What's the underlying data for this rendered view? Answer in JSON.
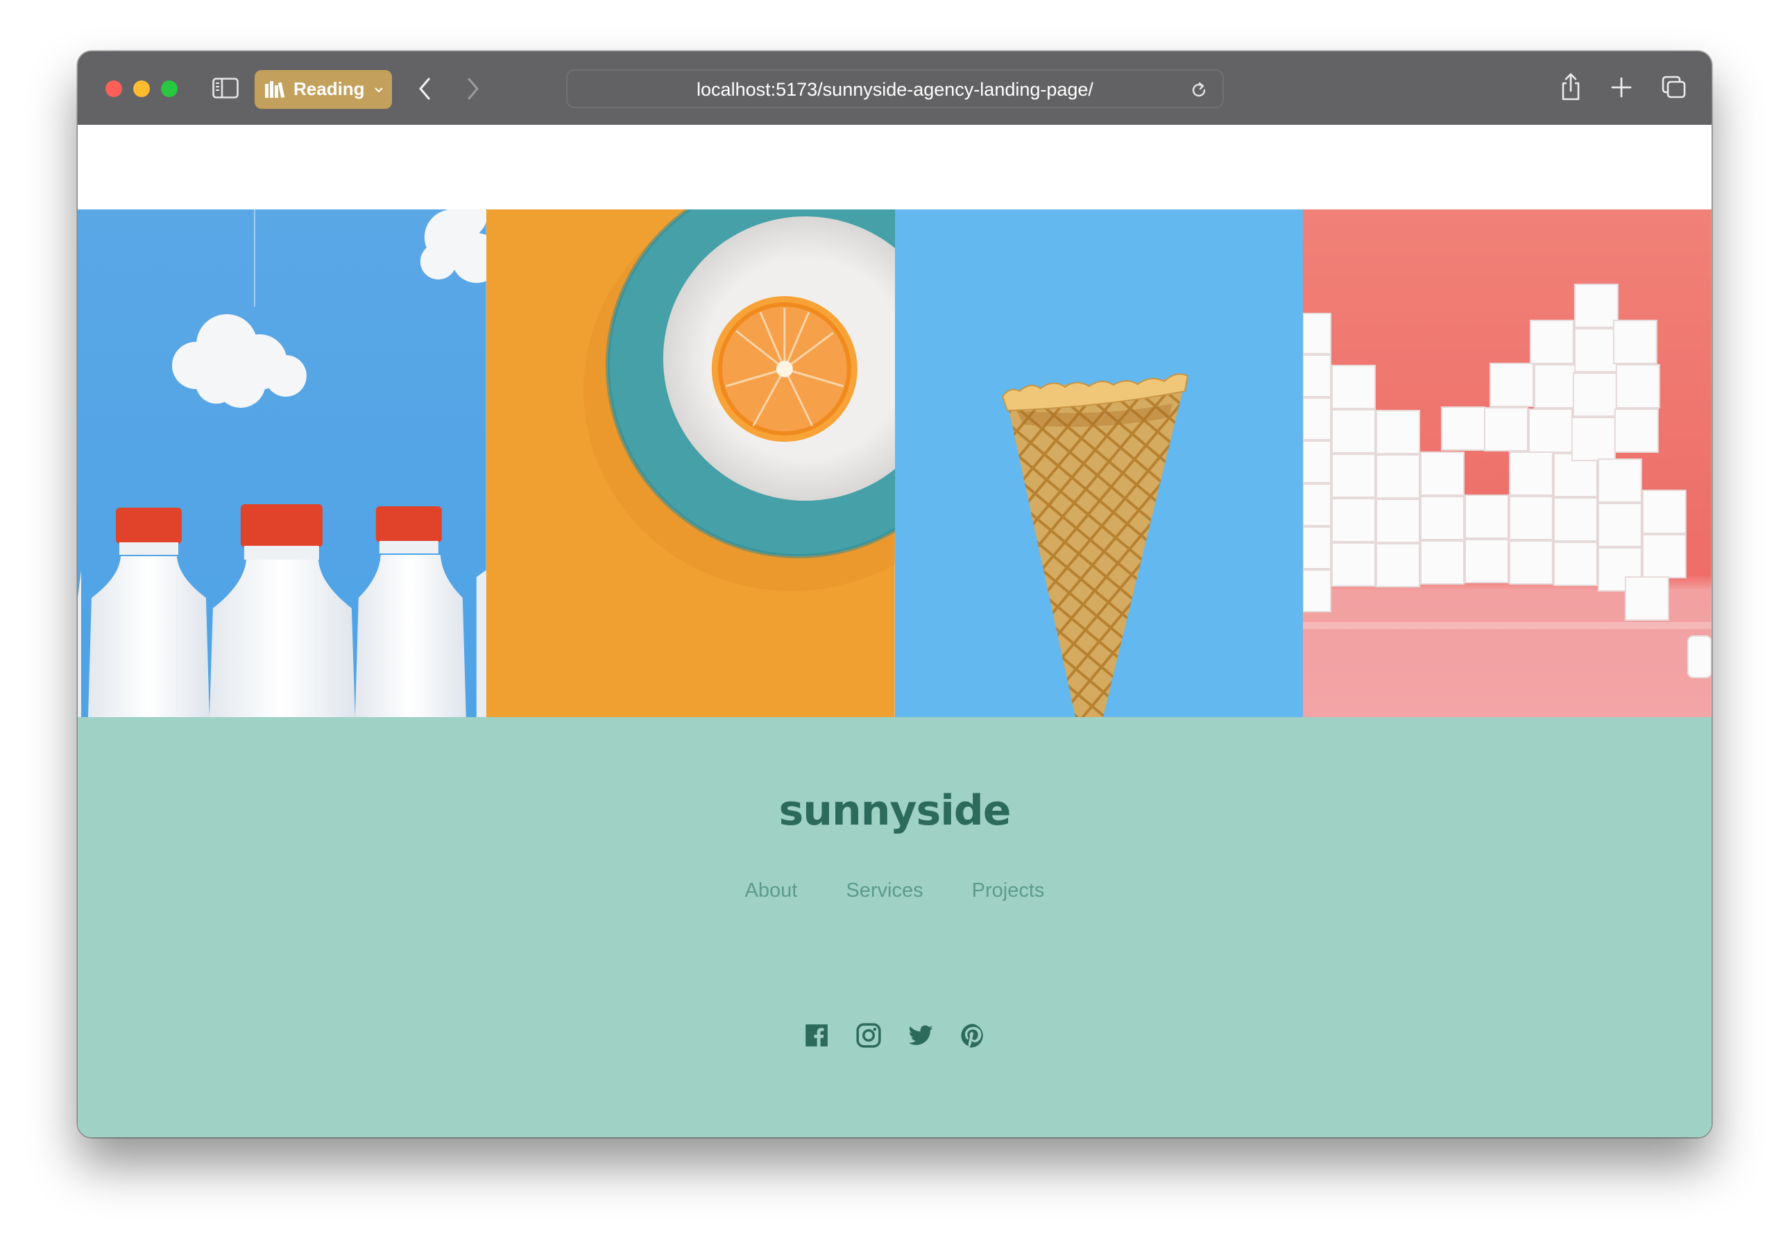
{
  "browser": {
    "reading_label": "Reading",
    "url": "localhost:5173/sunnyside-agency-landing-page/",
    "icons": {
      "sidebar": "sidebar-icon",
      "back": "chevron-left-icon",
      "forward": "chevron-right-icon",
      "reload": "reload-icon",
      "share": "share-icon",
      "new_tab": "plus-icon",
      "tabs": "tabs-overview-icon"
    }
  },
  "gallery": {
    "images": [
      "milk bottles",
      "orange on plate",
      "waffle cone",
      "sugar cubes"
    ]
  },
  "footer": {
    "logo": "sunnyside",
    "nav": [
      {
        "label": "About"
      },
      {
        "label": "Services"
      },
      {
        "label": "Projects"
      }
    ],
    "social": [
      "facebook-icon",
      "instagram-icon",
      "twitter-icon",
      "pinterest-icon"
    ],
    "colors": {
      "background": "#a0d1c5",
      "logo": "#2c6b5c",
      "links": "#5b9c8c"
    }
  }
}
